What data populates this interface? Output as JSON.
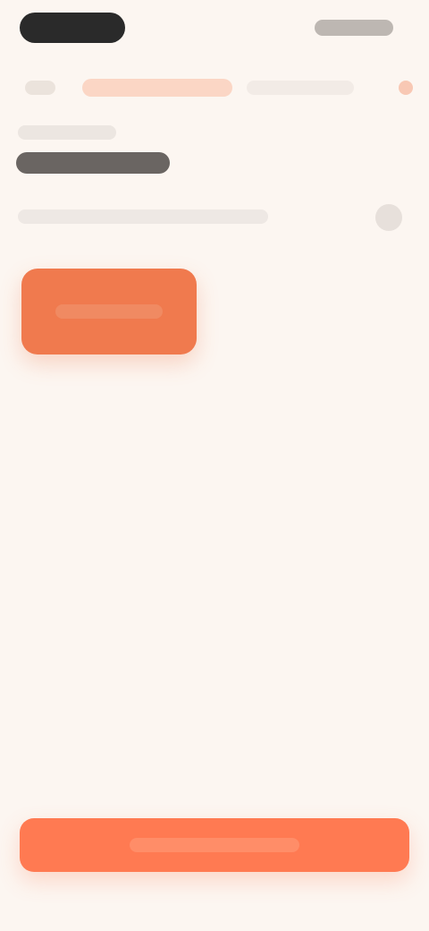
{
  "status_bar": {
    "left_pill": "",
    "right_text": ""
  },
  "tabs": {
    "active": "",
    "inactive": ""
  },
  "header": {
    "subtitle": "",
    "title": ""
  },
  "info": {
    "text": ""
  },
  "primary_action": {
    "label": ""
  },
  "bottom_action": {
    "label": ""
  },
  "colors": {
    "background": "#fcf6f1",
    "accent": "#f07a4e",
    "accent_button": "#ff7a52",
    "text_dark": "#2a2a2a"
  },
  "icons": {
    "status_left": "pill-shape",
    "tab_left": "back-icon",
    "tab_right": "status-dot-icon",
    "info_right": "circle-icon"
  }
}
